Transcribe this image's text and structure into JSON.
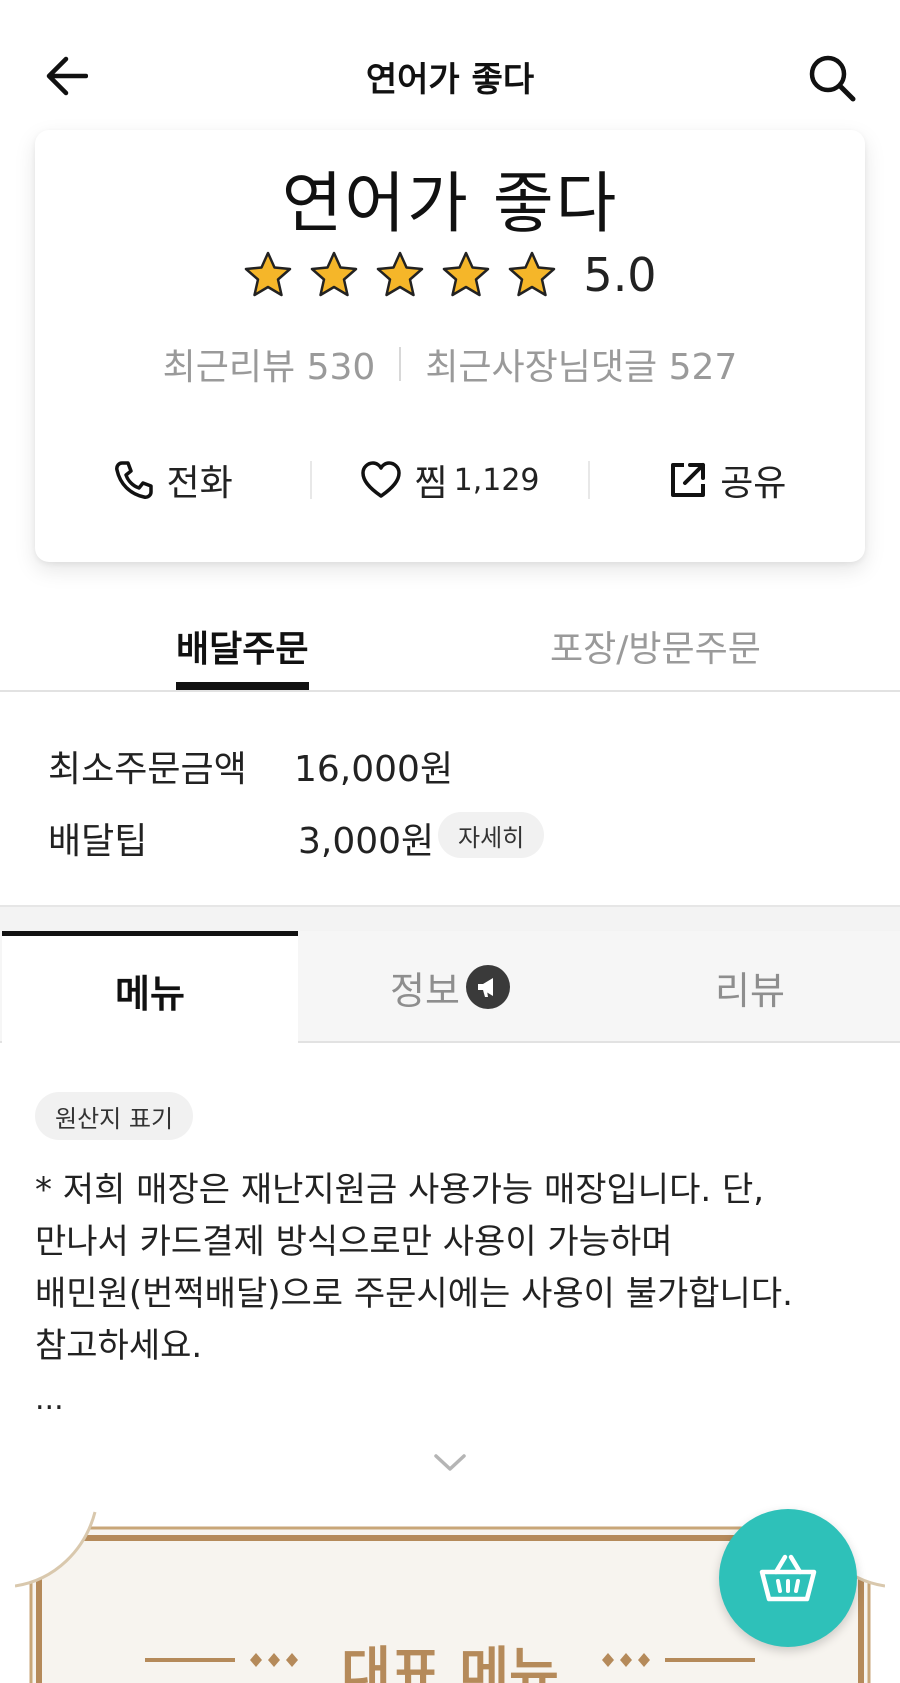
{
  "header": {
    "title": "연어가 좋다"
  },
  "store": {
    "name": "연어가 좋다",
    "rating_value": "5.0",
    "rating": 5,
    "rating_max": 5,
    "recent_reviews": "최근리뷰 530",
    "owner_replies": "최근사장님댓글 527",
    "actions": {
      "call_label": "전화",
      "like_label": "찜",
      "like_count": "1,129",
      "share_label": "공유"
    }
  },
  "order_tabs": {
    "delivery": "배달주문",
    "pickup": "포장/방문주문"
  },
  "order_info": {
    "min_order_label": "최소주문금액",
    "min_order_value": "16,000원",
    "delivery_tip_label": "배달팁",
    "delivery_tip_value": "3,000원",
    "detail_label": "자세히"
  },
  "menu_tabs": {
    "menu": "메뉴",
    "info": "정보",
    "review": "리뷰"
  },
  "notice": {
    "origin_chip": "원산지 표기",
    "lines": [
      "* 저희 매장은 재난지원금 사용가능 매장입니다. 단,",
      "만나서 카드결제 방식으로만 사용이 가능하며",
      "배민원(번쩍배달)으로 주문시에는 사용이 불가합니다.",
      "참고하세요."
    ],
    "ellipsis": "..."
  },
  "banner": {
    "title": "대표 메뉴"
  },
  "icons": {
    "back": "arrow-left-icon",
    "search": "search-icon",
    "phone": "phone-icon",
    "heart": "heart-icon",
    "share": "share-icon",
    "info_badge": "megaphone-icon",
    "expand": "chevron-down-icon",
    "cart": "basket-icon"
  },
  "colors": {
    "accent": "#2ec1b9",
    "star": "#f5b629",
    "banner_gold": "#b58a5a"
  }
}
